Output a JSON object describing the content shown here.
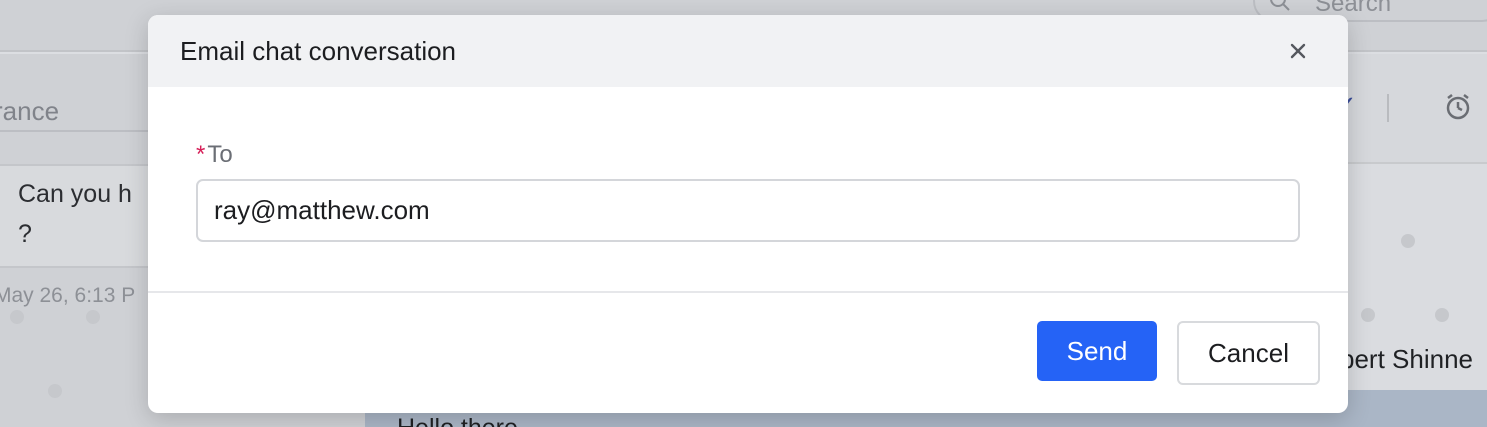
{
  "background": {
    "search_placeholder": "Search",
    "conversation_subject": "rance",
    "message_text": "Can you h\n?",
    "message_timestamp": "May 26, 6:13 P",
    "agent_name": "bert Shinne",
    "chat_preview": "Hello there"
  },
  "modal": {
    "title": "Email chat conversation",
    "to_label": "To",
    "required_mark": "*",
    "to_value": "ray@matthew.com",
    "send_label": "Send",
    "cancel_label": "Cancel"
  },
  "colors": {
    "primary": "#2563f6",
    "required": "#d61f58"
  },
  "icons": {
    "close": "close-icon",
    "search": "search-icon",
    "check": "check-icon",
    "alarm": "alarm-clock-icon"
  }
}
